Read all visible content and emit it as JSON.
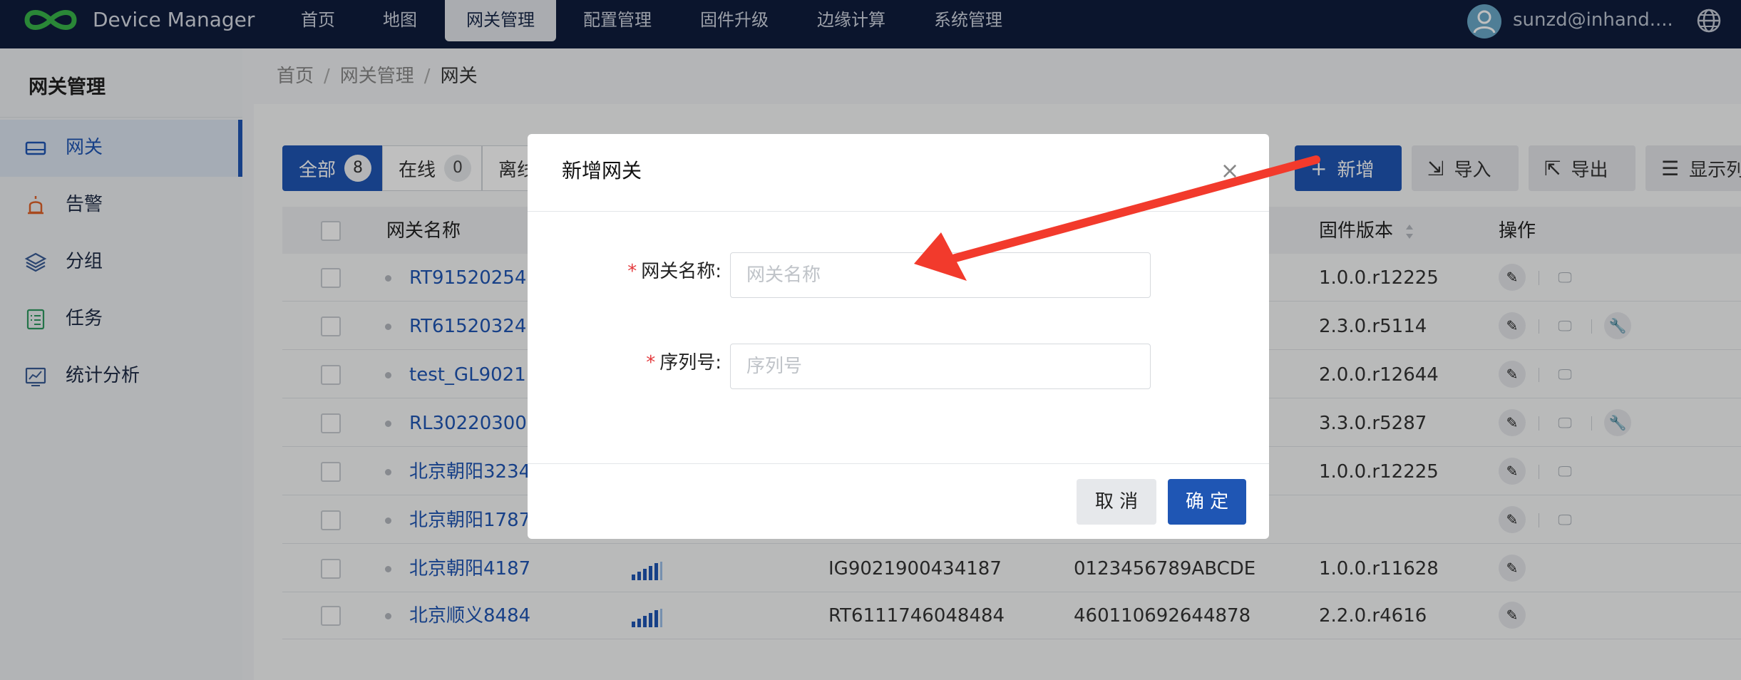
{
  "app": {
    "title": "Device Manager"
  },
  "nav": {
    "items": [
      {
        "label": "首页"
      },
      {
        "label": "地图"
      },
      {
        "label": "网关管理"
      },
      {
        "label": "配置管理"
      },
      {
        "label": "固件升级"
      },
      {
        "label": "边缘计算"
      },
      {
        "label": "系统管理"
      }
    ],
    "user": "sunzd@inhand...."
  },
  "sidebar": {
    "title": "网关管理",
    "items": [
      {
        "label": "网关",
        "icon": "gateway-icon"
      },
      {
        "label": "告警",
        "icon": "alarm-icon"
      },
      {
        "label": "分组",
        "icon": "layers-icon"
      },
      {
        "label": "任务",
        "icon": "task-list-icon"
      },
      {
        "label": "统计分析",
        "icon": "chart-icon"
      }
    ]
  },
  "breadcrumb": {
    "items": [
      "首页",
      "网关管理",
      "网关"
    ],
    "sep": "/"
  },
  "filters": [
    {
      "label": "全部",
      "count": "8"
    },
    {
      "label": "在线",
      "count": "0"
    },
    {
      "label": "离线"
    }
  ],
  "toolbar": {
    "add": "新增",
    "import": "导入",
    "export": "导出",
    "columns": "显示列"
  },
  "table": {
    "headers": {
      "name": "网关名称",
      "firmware": "固件版本",
      "actions": "操作"
    },
    "rows": [
      {
        "name": "RT91520254",
        "firmware": "1.0.0.r12225"
      },
      {
        "name": "RT61520324",
        "firmware": "2.3.0.r5114"
      },
      {
        "name": "test_GL9021",
        "firmware": "2.0.0.r12644"
      },
      {
        "name": "RL30220300",
        "firmware": "3.3.0.r5287"
      },
      {
        "name": "北京朝阳3234",
        "firmware": "1.0.0.r12225"
      },
      {
        "name": "北京朝阳1787",
        "firmware": ""
      },
      {
        "name": "北京朝阳4187",
        "serial": "IG9021900434187",
        "imei": "0123456789ABCDE",
        "firmware": "1.0.0.r11628"
      },
      {
        "name": "北京顺义8484",
        "serial": "RT6111746048484",
        "imei": "460110692644878",
        "firmware": "2.2.0.r4616"
      }
    ]
  },
  "modal": {
    "title": "新增网关",
    "name_label": "网关名称:",
    "name_placeholder": "网关名称",
    "serial_label": "序列号:",
    "serial_placeholder": "序列号",
    "cancel": "取 消",
    "ok": "确 定",
    "required_mark": "*"
  },
  "colors": {
    "primary": "#1f56b4",
    "topbar": "#0f1c3c",
    "arrow": "#f23a2c"
  }
}
